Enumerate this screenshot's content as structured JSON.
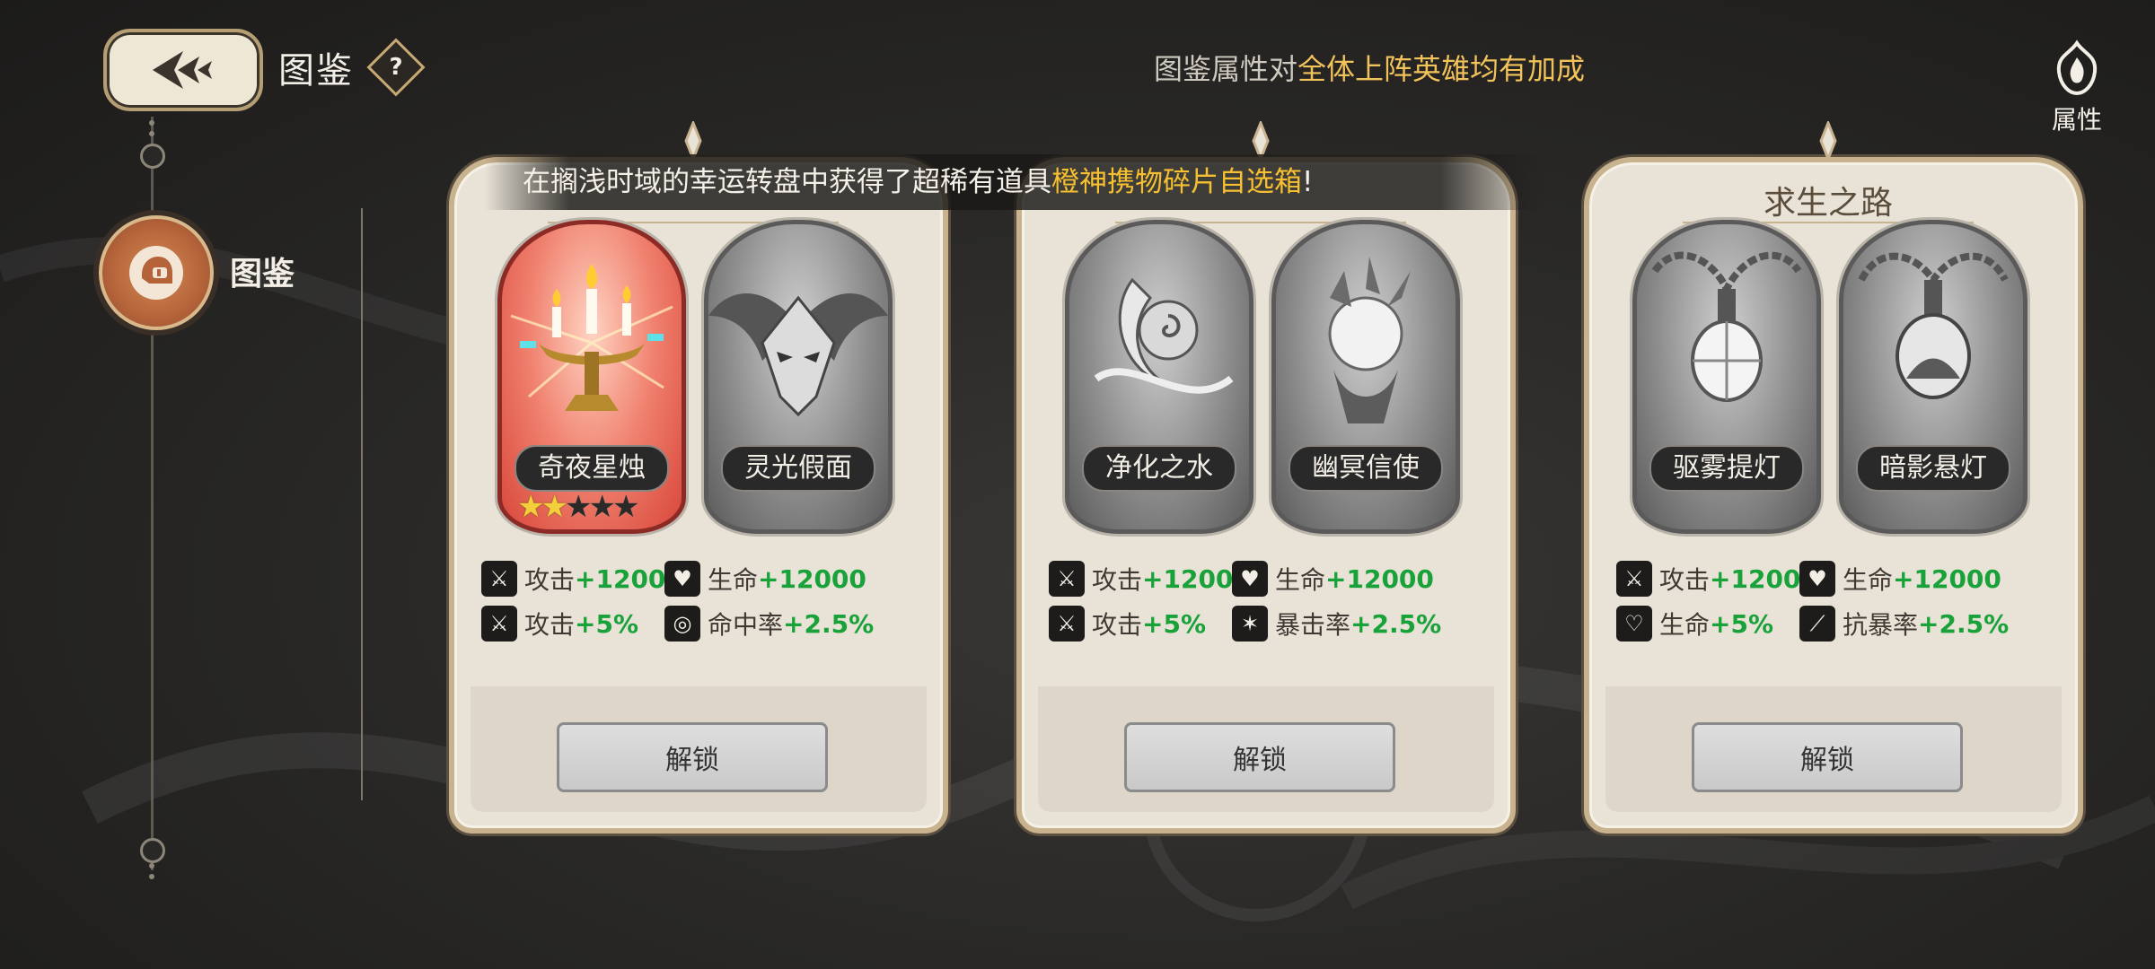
{
  "header": {
    "title": "图鉴",
    "help_icon": "question-mark",
    "note_prefix": "图鉴属性对",
    "note_highlight": "全体上阵英雄均有加成",
    "attr_label": "属性"
  },
  "sidebar": {
    "items": [
      {
        "label": "图鉴",
        "icon": "helmet-icon",
        "selected": true
      }
    ]
  },
  "notice": {
    "prefix": "在搁浅时域的幸运转盘中获得了超稀有道具",
    "highlight": "橙神携物碎片自选箱",
    "suffix": "!"
  },
  "cards": [
    {
      "title": "",
      "slots": [
        {
          "name": "奇夜星烛",
          "owned": true,
          "stars_on": 2,
          "stars_total": 5
        },
        {
          "name": "灵光假面",
          "owned": false
        }
      ],
      "stats": [
        {
          "icon": "attack-icon",
          "label": "攻击",
          "value": "+1200"
        },
        {
          "icon": "heart-icon",
          "label": "生命",
          "value": "+12000"
        },
        {
          "icon": "attack-icon",
          "label": "攻击",
          "value": "+5%"
        },
        {
          "icon": "target-icon",
          "label": "命中率",
          "value": "+2.5%"
        }
      ],
      "button": "解锁"
    },
    {
      "title": "",
      "slots": [
        {
          "name": "净化之水",
          "owned": false
        },
        {
          "name": "幽冥信使",
          "owned": false
        }
      ],
      "stats": [
        {
          "icon": "attack-icon",
          "label": "攻击",
          "value": "+1200"
        },
        {
          "icon": "heart-icon",
          "label": "生命",
          "value": "+12000"
        },
        {
          "icon": "attack-icon",
          "label": "攻击",
          "value": "+5%"
        },
        {
          "icon": "claw-icon",
          "label": "暴击率",
          "value": "+2.5%"
        }
      ],
      "button": "解锁"
    },
    {
      "title": "求生之路",
      "slots": [
        {
          "name": "驱雾提灯",
          "owned": false
        },
        {
          "name": "暗影悬灯",
          "owned": false
        }
      ],
      "stats": [
        {
          "icon": "attack-icon",
          "label": "攻击",
          "value": "+1200"
        },
        {
          "icon": "heart-icon",
          "label": "生命",
          "value": "+12000"
        },
        {
          "icon": "heartbeat-icon",
          "label": "生命",
          "value": "+5%"
        },
        {
          "icon": "boot-icon",
          "label": "抗暴率",
          "value": "+2.5%"
        }
      ],
      "button": "解锁"
    }
  ]
}
